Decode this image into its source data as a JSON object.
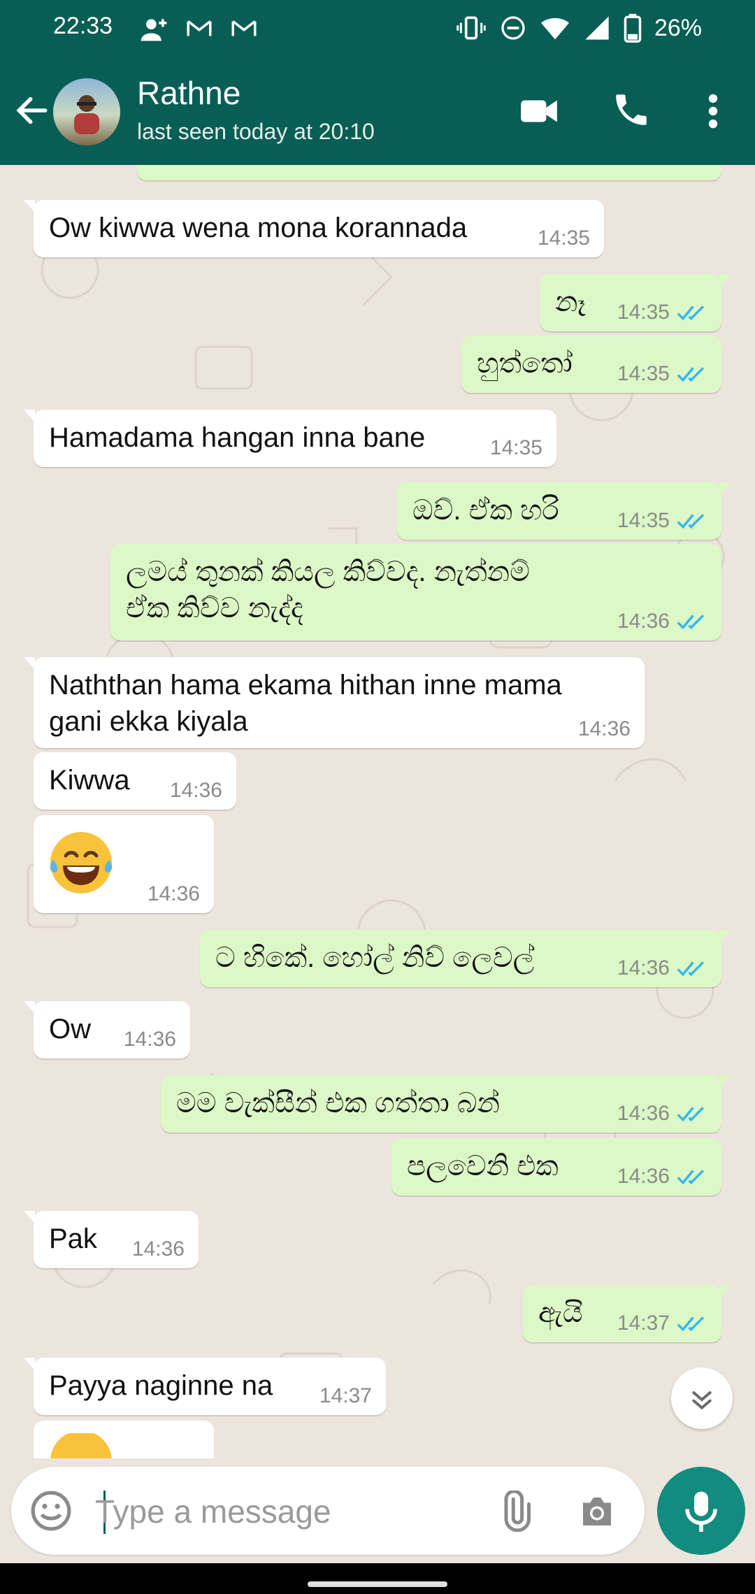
{
  "status_bar": {
    "time": "22:33",
    "battery": "26%",
    "icons": [
      "person-add-icon",
      "gmail-icon",
      "gmail-icon",
      "vibrate-icon",
      "dnd-icon",
      "wifi-icon",
      "signal-icon",
      "battery-icon"
    ]
  },
  "header": {
    "contact_name": "Rathne",
    "last_seen": "last seen today at 20:10",
    "actions": [
      "video-call-icon",
      "voice-call-icon",
      "more-options-icon"
    ]
  },
  "messages": [
    {
      "dir": "in",
      "text": "Ow kiwwa wena mona korannada",
      "time": "14:35"
    },
    {
      "dir": "out",
      "text": "නෑ",
      "time": "14:35"
    },
    {
      "dir": "out",
      "text": "හුත්තෝ",
      "time": "14:35"
    },
    {
      "dir": "in",
      "text": "Hamadama hangan inna bane",
      "time": "14:35"
    },
    {
      "dir": "out",
      "text": "ඔව්. ඒක හරි",
      "time": "14:35"
    },
    {
      "dir": "out",
      "text": "ලමය් තුනක් කියල කිව්වද. නැත්නම්\nඒක කිව්ව  නැද්ද",
      "time": "14:36"
    },
    {
      "dir": "in",
      "text": "Naththan hama ekama hithan inne mama\ngani ekka kiyala",
      "time": "14:36"
    },
    {
      "dir": "in",
      "text": "Kiwwa",
      "time": "14:36"
    },
    {
      "dir": "in",
      "text": "",
      "emoji": "tears-of-joy",
      "time": "14:36"
    },
    {
      "dir": "out",
      "text": "ට හිකේ. හෝල් නිව් ලෙවල්",
      "time": "14:36"
    },
    {
      "dir": "in",
      "text": "Ow",
      "time": "14:36"
    },
    {
      "dir": "out",
      "text": "මම වැක්සීන්  එක ගත්තා බන්",
      "time": "14:36"
    },
    {
      "dir": "out",
      "text": "පලවෙනි එක",
      "time": "14:36"
    },
    {
      "dir": "in",
      "text": "Pak",
      "time": "14:36"
    },
    {
      "dir": "out",
      "text": "ඇයි",
      "time": "14:37"
    },
    {
      "dir": "in",
      "text": "Payya naginne na",
      "time": "14:37"
    }
  ],
  "composer": {
    "placeholder": "Type a message",
    "value": ""
  },
  "colors": {
    "primary": "#075E54",
    "accent": "#128C7E",
    "outgoing": "#DCF8C6",
    "incoming": "#FFFFFF",
    "read_ticks": "#34B7F1"
  }
}
